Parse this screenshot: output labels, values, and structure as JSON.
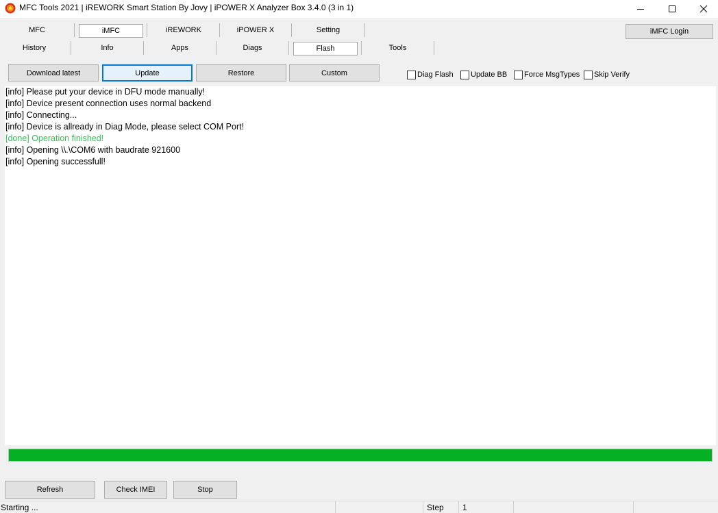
{
  "window": {
    "title": "MFC Tools 2021 | iREWORK Smart Station By Jovy | iPOWER X Analyzer Box 3.4.0 (3 in 1)",
    "icon": "mfc-app-icon",
    "controls": {
      "minimize": "minimize-icon",
      "maximize": "maximize-icon",
      "close": "close-icon"
    }
  },
  "top_tabs": [
    {
      "label": "MFC",
      "selected": false
    },
    {
      "label": "iMFC",
      "selected": true
    },
    {
      "label": "iREWORK",
      "selected": false
    },
    {
      "label": "iPOWER X",
      "selected": false
    },
    {
      "label": "Setting",
      "selected": false
    }
  ],
  "login_button": "iMFC Login",
  "sub_tabs": [
    {
      "label": "History",
      "selected": false
    },
    {
      "label": "Info",
      "selected": false
    },
    {
      "label": "Apps",
      "selected": false
    },
    {
      "label": "Diags",
      "selected": false
    },
    {
      "label": "Flash",
      "selected": true
    },
    {
      "label": "Tools",
      "selected": false
    }
  ],
  "actions": {
    "download_latest": "Download latest",
    "update": "Update",
    "restore": "Restore",
    "custom": "Custom"
  },
  "options": {
    "diag_flash": {
      "label": "Diag Flash",
      "checked": false
    },
    "update_bb": {
      "label": "Update BB",
      "checked": false
    },
    "force_msgtypes": {
      "label": "Force MsgTypes",
      "checked": false
    },
    "skip_verify": {
      "label": "Skip Verify",
      "checked": false
    }
  },
  "log": [
    {
      "text": "[info] Please put your device in DFU mode manually!",
      "kind": "info"
    },
    {
      "text": "[info] Device present connection uses normal backend",
      "kind": "info"
    },
    {
      "text": "[info] Connecting...",
      "kind": "info"
    },
    {
      "text": "[info] Device is allready in Diag Mode, please select COM Port!",
      "kind": "info"
    },
    {
      "text": "[done] Operation finished!",
      "kind": "done"
    },
    {
      "text": "[info] Opening \\\\.\\COM6 with baudrate 921600",
      "kind": "info"
    },
    {
      "text": "[info] Opening successfull!",
      "kind": "info"
    }
  ],
  "progress": {
    "percent": 100,
    "color": "#06b025"
  },
  "bottom_buttons": {
    "refresh": "Refresh",
    "check_imei": "Check IMEI",
    "stop": "Stop"
  },
  "status": {
    "message": "Starting ...",
    "step_label": "Step",
    "step_value": "1"
  },
  "colors": {
    "done_text": "#35c35a",
    "focus_border": "#0078d7"
  }
}
